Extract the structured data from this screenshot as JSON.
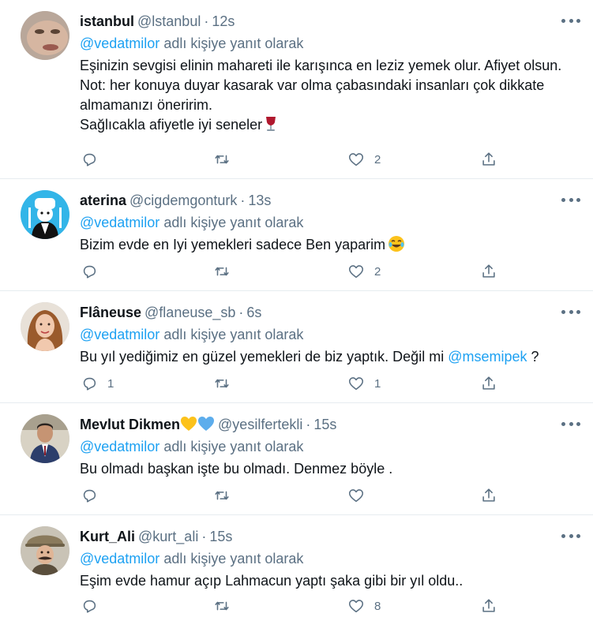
{
  "colors": {
    "accent": "#1da1f2",
    "muted": "#5b7083",
    "text": "#0f1419",
    "divider": "#e6ecf0"
  },
  "icons": [
    "reply-icon",
    "retweet-icon",
    "like-icon",
    "share-icon",
    "more-options-icon"
  ],
  "tweets": [
    {
      "name": "istanbul",
      "handle": "@lstanbul",
      "time": "12s",
      "reply_to": {
        "mention": "@vedatmilor",
        "text": "adlı kişiye yanıt olarak"
      },
      "lines": [
        "Eşinizin sevgisi elinin mahareti ile karışınca en leziz yemek olur. Afiyet olsun.",
        "Not: her konuya duyar kasarak var olma çabasındaki insanları çok dikkate",
        "almamanızı öneririm.",
        "Sağlıcakla afiyetle iyi seneler"
      ],
      "emoji": "wine-glass-emoji",
      "counts": {
        "reply": "",
        "retweet": "",
        "like": "2"
      }
    },
    {
      "name": "aterina",
      "handle": "@cigdemgonturk",
      "time": "13s",
      "reply_to": {
        "mention": "@vedatmilor",
        "text": "adlı kişiye yanıt olarak"
      },
      "lines": [
        "Bizim evde en Iyi yemekleri sadece Ben yaparim"
      ],
      "emoji": "tears-of-joy-emoji",
      "counts": {
        "reply": "",
        "retweet": "",
        "like": "2"
      }
    },
    {
      "name": "Flâneuse",
      "handle": "@flaneuse_sb",
      "time": "6s",
      "reply_to": {
        "mention": "@vedatmilor",
        "text": "adlı kişiye yanıt olarak"
      },
      "line_before": "Bu yıl yediğimiz en güzel yemekleri de biz yaptık. Değil mi",
      "inline_mention": "@msemipek",
      "line_after": "?",
      "counts": {
        "reply": "1",
        "retweet": "",
        "like": "1"
      }
    },
    {
      "name": "Mevlut Dikmen",
      "handle": "@yesilfertekli",
      "time": "15s",
      "reply_to": {
        "mention": "@vedatmilor",
        "text": "adlı kişiye yanıt olarak"
      },
      "lines": [
        "Bu olmadı başkan işte bu olmadı. Denmez böyle ."
      ],
      "counts": {
        "reply": "",
        "retweet": "",
        "like": ""
      }
    },
    {
      "name": "Kurt_Ali",
      "handle": "@kurt_ali",
      "time": "15s",
      "reply_to": {
        "mention": "@vedatmilor",
        "text": "adlı kişiye yanıt olarak"
      },
      "lines": [
        "Eşim evde hamur açıp Lahmacun yaptı şaka gibi bir yıl oldu.."
      ],
      "counts": {
        "reply": "",
        "retweet": "",
        "like": "8"
      }
    }
  ],
  "separator_dot": "·"
}
